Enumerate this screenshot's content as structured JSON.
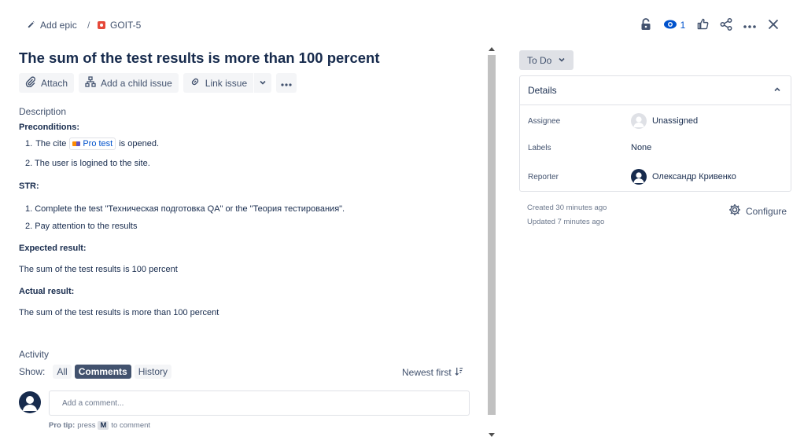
{
  "breadcrumb": {
    "add_epic": "Add epic",
    "separator": "/",
    "issue_key": "GOIT-5"
  },
  "top_actions": {
    "watch_count": "1"
  },
  "issue": {
    "title": "The sum of the test results is more than 100 percent"
  },
  "toolbar": {
    "attach": "Attach",
    "add_child": "Add a child issue",
    "link_issue": "Link issue"
  },
  "description": {
    "label": "Description",
    "preconditions_heading": "Preconditions:",
    "pre1_num": "1.",
    "pre1_before": "The cite",
    "pre1_link": "Pro test",
    "pre1_after": "is opened.",
    "pre2": "2. The user is logined to the site.",
    "str_heading": "STR:",
    "str1": "1. Complete the test \"Техническая подготовка QA\" or the \"Теория тестирования\".",
    "str2": "2. Pay attention to the results",
    "expected_heading": "Expected result:",
    "expected": "The sum of the test results is 100 percent",
    "actual_heading": "Actual result:",
    "actual": "The sum of the test results is more than 100 percent"
  },
  "activity": {
    "label": "Activity",
    "show_label": "Show:",
    "filters": [
      "All",
      "Comments",
      "History"
    ],
    "active_filter": "Comments",
    "sort_label": "Newest first",
    "comment_placeholder": "Add a comment...",
    "protip_label": "Pro tip:",
    "protip_press": "press",
    "protip_key": "M",
    "protip_rest": "to comment"
  },
  "sidebar": {
    "status": "To Do",
    "details_title": "Details",
    "assignee_label": "Assignee",
    "assignee_value": "Unassigned",
    "labels_label": "Labels",
    "labels_value": "None",
    "reporter_label": "Reporter",
    "reporter_value": "Олександр Кривенко",
    "created": "Created 30 minutes ago",
    "updated": "Updated 7 minutes ago",
    "configure": "Configure"
  },
  "colors": {
    "primary_text": "#172b4d",
    "secondary_text": "#42526e",
    "link": "#0052cc",
    "bug_icon": "#e5493a",
    "button_bg": "#f4f5f7"
  },
  "icons": [
    "pencil-icon",
    "bug-icon",
    "lock-open-icon",
    "eye-icon",
    "thumbs-up-icon",
    "share-icon",
    "more-icon",
    "close-icon",
    "paperclip-icon",
    "hierarchy-icon",
    "link-icon",
    "chevron-down-icon",
    "chevron-up-icon",
    "sort-icon",
    "gear-icon",
    "user-avatar-icon"
  ]
}
